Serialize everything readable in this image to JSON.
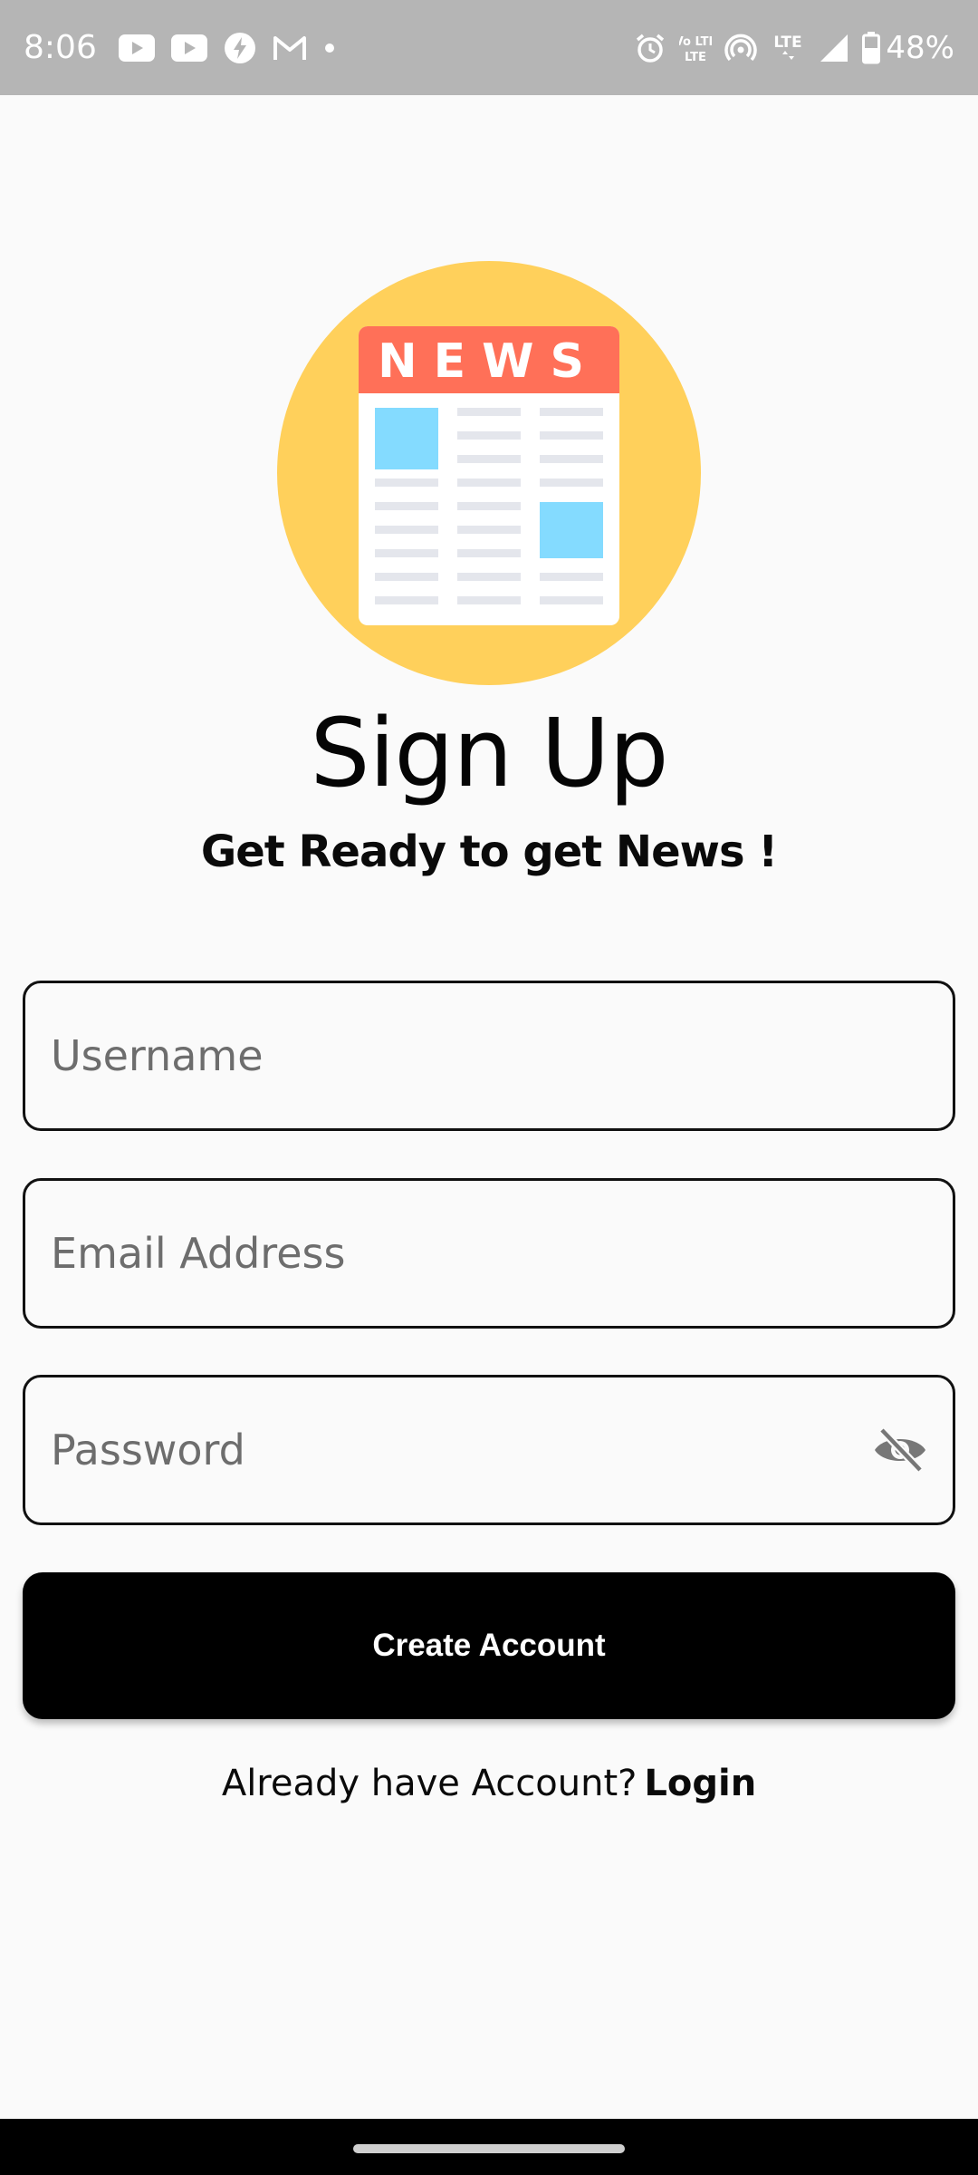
{
  "status_bar": {
    "time": "8:06",
    "battery": "48%",
    "left_icons": [
      "youtube-icon",
      "youtube-icon",
      "messenger-icon",
      "gmail-icon",
      "dot-icon"
    ],
    "right_icons": [
      "alarm-icon",
      "volte-icon",
      "hotspot-icon",
      "lte-icon",
      "signal-icon",
      "battery-icon"
    ],
    "volte_label": "Vo LTE",
    "lte_label": "LTE"
  },
  "logo": {
    "text": "NEWS",
    "circle_color": "#ffd05b",
    "header_color": "#ff7058",
    "image_block_color": "#84dbff"
  },
  "title": "Sign Up",
  "subtitle": "Get Ready to get News !",
  "form": {
    "username_placeholder": "Username",
    "email_placeholder": "Email Address",
    "password_placeholder": "Password",
    "submit_label": "Create Account"
  },
  "footer": {
    "prompt": "Already have Account?",
    "login_label": "Login"
  }
}
